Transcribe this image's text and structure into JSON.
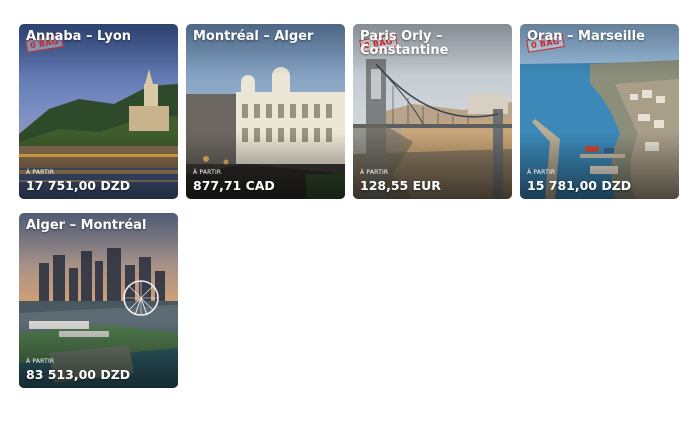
{
  "from_label": "À PARTIR",
  "stamp_label": "0 BAG",
  "cards": [
    {
      "route": "Annaba – Lyon",
      "price": "17 751,00 DZD",
      "has_stamp": true
    },
    {
      "route": "Montréal – Alger",
      "price": "877,71 CAD",
      "has_stamp": false
    },
    {
      "route": "Paris Orly – Constantine",
      "price": "128,55 EUR",
      "has_stamp": true
    },
    {
      "route": "Oran – Marseille",
      "price": "15 781,00 DZD",
      "has_stamp": true
    },
    {
      "route": "Alger – Montréal",
      "price": "83 513,00 DZD",
      "has_stamp": false
    }
  ]
}
